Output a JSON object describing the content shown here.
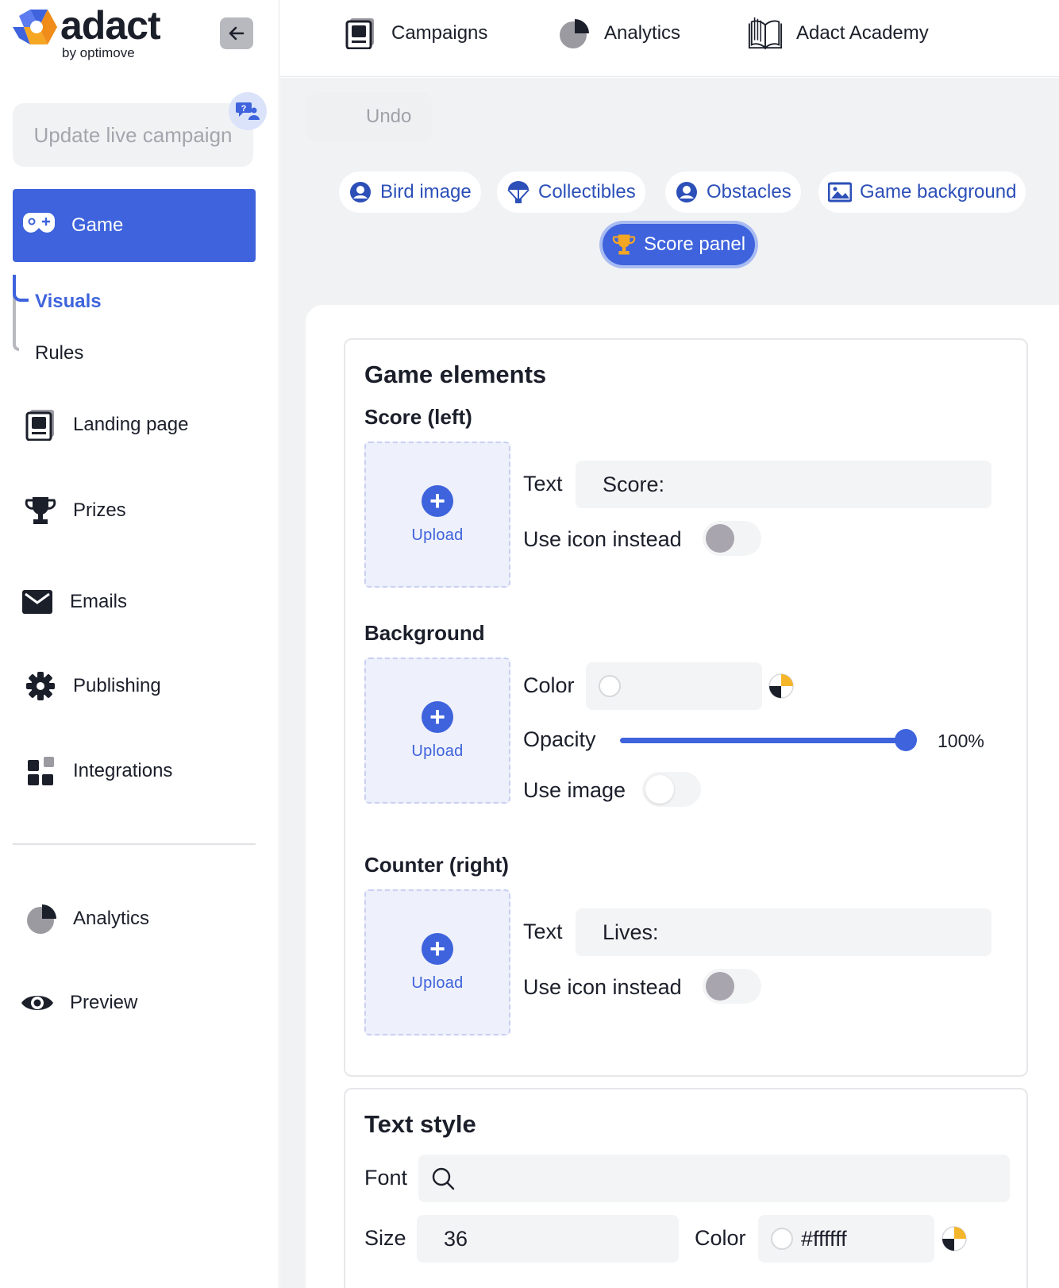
{
  "brand": {
    "name": "adact",
    "sub": "by optimove",
    "accent": "#3e63dd"
  },
  "sidebar": {
    "update_label": "Update live campaign",
    "game_label": "Game",
    "sub_items": [
      "Visuals",
      "Rules"
    ],
    "items": [
      {
        "label": "Landing page",
        "icon": "landing-page-icon"
      },
      {
        "label": "Prizes",
        "icon": "trophy-icon"
      },
      {
        "label": "Emails",
        "icon": "envelope-icon"
      },
      {
        "label": "Publishing",
        "icon": "gear-icon"
      },
      {
        "label": "Integrations",
        "icon": "grid-icon"
      },
      {
        "label": "Analytics",
        "icon": "pie-chart-icon"
      },
      {
        "label": "Preview",
        "icon": "eye-icon"
      }
    ]
  },
  "topbar": {
    "links": [
      {
        "label": "Campaigns",
        "icon": "campaigns-icon"
      },
      {
        "label": "Analytics",
        "icon": "pie-chart-icon"
      },
      {
        "label": "Adact Academy",
        "icon": "book-icon"
      }
    ]
  },
  "toolbar": {
    "undo_label": "Undo"
  },
  "tabs": [
    {
      "label": "Bird image",
      "icon": "user-circle-icon"
    },
    {
      "label": "Collectibles",
      "icon": "parachute-icon"
    },
    {
      "label": "Obstacles",
      "icon": "user-circle-icon"
    },
    {
      "label": "Game background",
      "icon": "image-icon"
    },
    {
      "label": "Score panel",
      "icon": "trophy-icon",
      "active": true
    }
  ],
  "game_elements": {
    "title": "Game elements",
    "score": {
      "title": "Score (left)",
      "upload_label": "Upload",
      "text_label": "Text",
      "text_value": "Score:",
      "use_icon_label": "Use icon instead",
      "use_icon": false
    },
    "background": {
      "title": "Background",
      "upload_label": "Upload",
      "color_label": "Color",
      "color_value": "",
      "opacity_label": "Opacity",
      "opacity_value": 100,
      "opacity_text": "100%",
      "use_image_label": "Use image",
      "use_image": false
    },
    "counter": {
      "title": "Counter (right)",
      "upload_label": "Upload",
      "text_label": "Text",
      "text_value": "Lives:",
      "use_icon_label": "Use icon instead",
      "use_icon": false
    }
  },
  "text_style": {
    "title": "Text style",
    "font_label": "Font",
    "font_value": "",
    "size_label": "Size",
    "size_value": "36",
    "color_label": "Color",
    "color_value": "#ffffff"
  }
}
